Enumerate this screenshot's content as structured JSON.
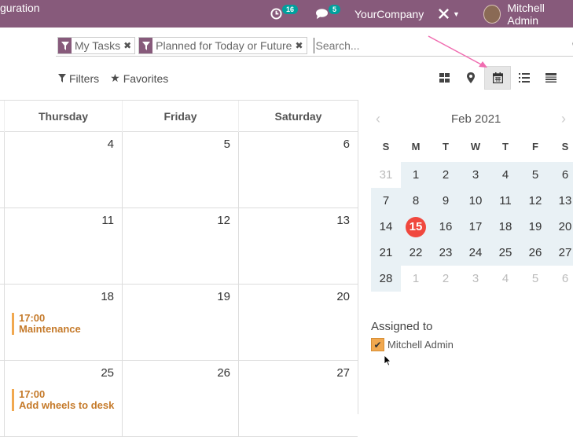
{
  "navbar": {
    "menu_text": "guration",
    "activity_badge": "16",
    "messages_badge": "5",
    "company": "YourCompany",
    "user": "Mitchell Admin"
  },
  "search": {
    "facets": [
      {
        "label": "My Tasks"
      },
      {
        "label": "Planned for Today or Future"
      }
    ],
    "placeholder": "Search..."
  },
  "toolbar": {
    "filters_label": "Filters",
    "favorites_label": "Favorites"
  },
  "calendar": {
    "headers": [
      "Thursday",
      "Friday",
      "Saturday"
    ],
    "weeks": [
      {
        "days": [
          "4",
          "5",
          "6"
        ]
      },
      {
        "days": [
          "11",
          "12",
          "13"
        ]
      },
      {
        "days": [
          "18",
          "19",
          "20"
        ],
        "event": {
          "time": "17:00",
          "title": "Maintenance"
        }
      },
      {
        "days": [
          "25",
          "26",
          "27"
        ],
        "event": {
          "time": "17:00",
          "title": "Add wheels to desk"
        }
      }
    ]
  },
  "mini_calendar": {
    "title": "Feb 2021",
    "weekdays": [
      "S",
      "M",
      "T",
      "W",
      "T",
      "F",
      "S"
    ],
    "rows": [
      [
        "31",
        "1",
        "2",
        "3",
        "4",
        "5",
        "6"
      ],
      [
        "7",
        "8",
        "9",
        "10",
        "11",
        "12",
        "13"
      ],
      [
        "14",
        "15",
        "16",
        "17",
        "18",
        "19",
        "20"
      ],
      [
        "21",
        "22",
        "23",
        "24",
        "25",
        "26",
        "27"
      ],
      [
        "28",
        "1",
        "2",
        "3",
        "4",
        "5",
        "6"
      ]
    ],
    "today": "15"
  },
  "assigned": {
    "title": "Assigned to",
    "items": [
      {
        "label": "Mitchell Admin",
        "checked": true
      }
    ]
  },
  "colors": {
    "brand": "#875a7b",
    "badge": "#00a09d",
    "event": "#f1a84f",
    "today": "#f0483e",
    "annotation_arrow": "#f06cb0"
  }
}
